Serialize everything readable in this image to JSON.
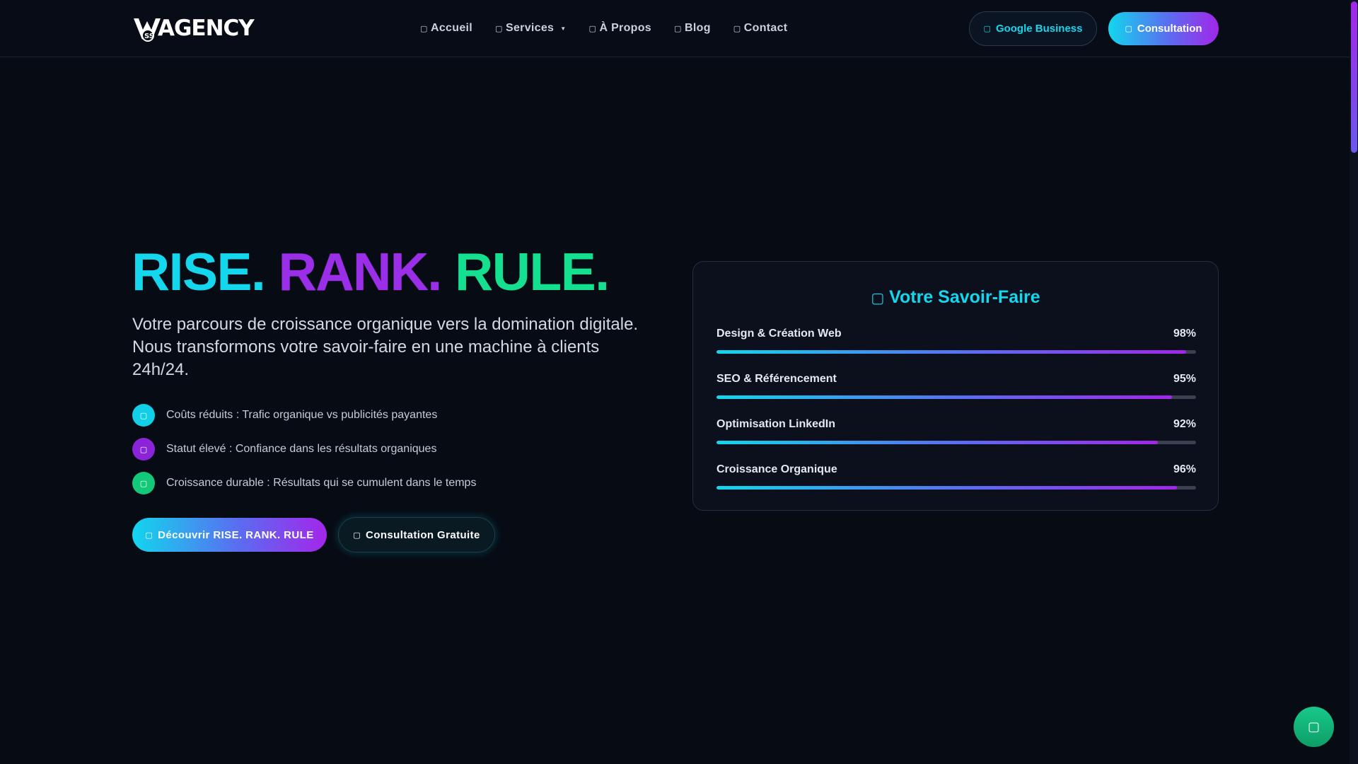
{
  "brand": {
    "logo_text": "AGENCY"
  },
  "nav": {
    "items": [
      {
        "label": "Accueil",
        "icon": "home-icon"
      },
      {
        "label": "Services",
        "icon": "grid-icon",
        "has_dropdown": true
      },
      {
        "label": "À Propos",
        "icon": "info-icon"
      },
      {
        "label": "Blog",
        "icon": "blog-icon"
      },
      {
        "label": "Contact",
        "icon": "envelope-icon"
      }
    ],
    "google_business_label": "Google Business",
    "consultation_label": "Consultation"
  },
  "hero": {
    "title_part1": "RISE.",
    "title_part2": "RANK.",
    "title_part3": "RULE.",
    "subtitle": "Votre parcours de croissance organique vers la domination digitale. Nous transformons votre savoir-faire en une machine à clients 24h/24.",
    "features": [
      {
        "text": "Coûts réduits : Trafic organique vs publicités payantes",
        "color": "#10cfe6"
      },
      {
        "text": "Statut élevé : Confiance dans les résultats organiques",
        "color": "#8b24d8"
      },
      {
        "text": "Croissance durable : Résultats qui se cumulent dans le temps",
        "color": "#12c87a"
      }
    ],
    "discover_button": "Découvrir RISE. RANK. RULE",
    "free_consult_button": "Consultation Gratuite"
  },
  "skills_card": {
    "title": "Votre Savoir-Faire",
    "skills": [
      {
        "label": "Design & Création Web",
        "percent_text": "98%",
        "value": 98
      },
      {
        "label": "SEO & Référencement",
        "percent_text": "95%",
        "value": 95
      },
      {
        "label": "Optimisation LinkedIn",
        "percent_text": "92%",
        "value": 92
      },
      {
        "label": "Croissance Organique",
        "percent_text": "96%",
        "value": 96
      }
    ]
  },
  "colors": {
    "accent_cyan": "#14d6ec",
    "accent_purple": "#9b2ee8",
    "accent_green": "#15e08f",
    "background": "#070b14"
  },
  "fab": {
    "icon": "whatsapp-icon"
  }
}
